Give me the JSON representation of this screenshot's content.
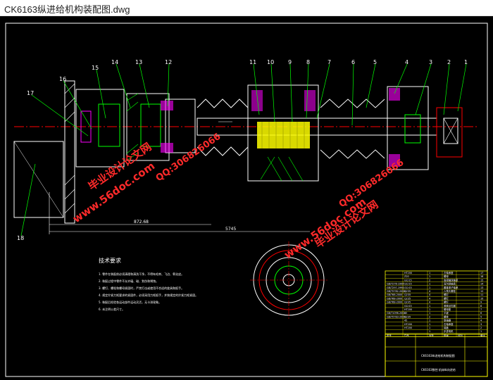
{
  "window": {
    "title": "CK6163纵进给机构装配图.dwg"
  },
  "drawing": {
    "balloons_top": [
      "17",
      "16",
      "15",
      "14",
      "13",
      "12",
      "11",
      "10",
      "9",
      "8",
      "7",
      "6",
      "5",
      "4",
      "3",
      "2",
      "1"
    ],
    "balloon_left": "18",
    "dims": [
      "872.68",
      "5745"
    ],
    "tech_title": "技术要求",
    "tech_lines": [
      "1. 零件在装配前必须清理和清洗干净，不得有毛刺、飞边、氧化皮。",
      "2. 装配过程中零件不允许磕、碰、划伤和锈蚀。",
      "3. 螺钉、螺栓和螺母紧固时，严禁打击或使用不合适的旋具和扳手。",
      "4. 规定拧紧力矩要求的紧固件，必须采用力矩扳手，并按规定的拧紧力矩紧固。",
      "5. 装配后检验各运动部件运动灵活，无卡滞现象。",
      "6. 未注明公差尺寸。"
    ],
    "bom_rows": [
      {
        "std": "",
        "mat": "HT200",
        "qty": "1",
        "name": "左轴承座",
        "no": "17"
      },
      {
        "std": "",
        "mat": "Z20",
        "qty": "1",
        "name": "螺母",
        "no": "16"
      },
      {
        "std": "",
        "mat": "GCr15",
        "qty": "2",
        "name": "角接触球轴承",
        "no": "15"
      },
      {
        "std": "GB/T276-1994",
        "mat": "GCr15",
        "qty": "1",
        "name": "深沟球轴承",
        "no": "14"
      },
      {
        "std": "GB/T297-1994",
        "mat": "GCr15",
        "qty": "1",
        "name": "圆锥滚子轴承",
        "no": "13"
      },
      {
        "std": "GB/T5782-2000",
        "mat": "Q235",
        "qty": "4",
        "name": "六角头螺栓",
        "no": "12"
      },
      {
        "std": "GB/T68-2000",
        "mat": "Q235",
        "qty": "4",
        "name": "螺钉",
        "no": "11"
      },
      {
        "std": "GB/T68-2000",
        "mat": "Q235",
        "qty": "4",
        "name": "螺钉",
        "no": "10"
      },
      {
        "std": "GB/T68-2000",
        "mat": "Q235",
        "qty": "4",
        "name": "螺钉",
        "no": "9"
      },
      {
        "std": "",
        "mat": "GCr15",
        "qty": "1",
        "name": "滚珠丝杠副",
        "no": "8"
      },
      {
        "std": "",
        "mat": "HT200",
        "qty": "1",
        "name": "螺母座",
        "no": "7"
      },
      {
        "std": "GB/T1096-2003",
        "mat": "45",
        "qty": "1",
        "name": "平键",
        "no": "6"
      },
      {
        "std": "GB/T5783-2000",
        "mat": "Q235",
        "qty": "2",
        "name": "螺栓",
        "no": "5"
      },
      {
        "std": "",
        "mat": "45",
        "qty": "1",
        "name": "联轴器",
        "no": "4"
      },
      {
        "std": "",
        "mat": "HT200",
        "qty": "1",
        "name": "右轴承座",
        "no": "3"
      },
      {
        "std": "",
        "mat": "HT200",
        "qty": "1",
        "name": "端盖",
        "no": "2"
      },
      {
        "std": "",
        "mat": "",
        "qty": "1",
        "name": "步进电机",
        "no": "1"
      }
    ],
    "bom_header": [
      "序号",
      "代号",
      "名称",
      "数量",
      "材料",
      "备注"
    ],
    "title_block_name": "CK6163纵进给机构装配图",
    "title_block_sub": "CK6163数控 机床纵向进给"
  },
  "watermarks": [
    "www.56doc.com",
    "毕业设计论文网",
    "QQ:306826066"
  ],
  "colors": {
    "bg": "#000000",
    "white": "#ffffff",
    "green": "#00ff00",
    "yellow": "#ffff00",
    "magenta": "#ff00ff",
    "cyan": "#00ffff",
    "red": "#ff0000"
  }
}
